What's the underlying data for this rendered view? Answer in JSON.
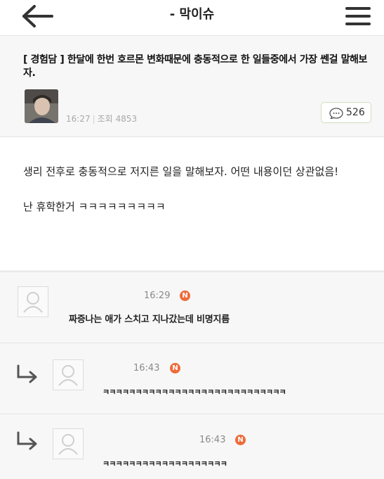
{
  "header": {
    "board_title": "- 막이슈",
    "back_icon": "arrow-left-icon",
    "menu_icon": "hamburger-menu-icon"
  },
  "post": {
    "title": "[ 경험담 ] 한달에 한번 호르몬 변화때문에 충동적으로 한 일들중에서 가장 쎈걸 말해보자.",
    "time": "16:27",
    "views_label": "조회",
    "views": "4853",
    "comment_count": "526",
    "body": [
      "생리 전후로 충동적으로 저지른 일을 말해보자. 어떤 내용이던 상관없음!",
      "난 휴학한거 ㅋㅋㅋㅋㅋㅋㅋㅋㅋ"
    ]
  },
  "comments": [
    {
      "time": "16:29",
      "badge": "N",
      "text": "짜증나는 애가 스치고 지나갔는데 비명지름",
      "is_reply": false
    },
    {
      "time": "16:43",
      "badge": "N",
      "text": "ㅋㅋㅋㅋㅋㅋㅋㅋㅋㅋㅋㅋㅋㅋㅋㅋㅋㅋㅋㅋㅋㅋㅋㅋㅋㅋㅋㅋ",
      "is_reply": true
    },
    {
      "time": "16:43",
      "badge": "N",
      "text": "ㅋㅋㅋㅋㅋㅋㅋㅋㅋㅋㅋㅋㅋㅋㅋㅋㅋㅋㅋ",
      "is_reply": true
    }
  ],
  "colors": {
    "badge": "#ee6b3a",
    "comment_button_border": "#cfe0c0",
    "header_background": "#f7f7f7"
  }
}
